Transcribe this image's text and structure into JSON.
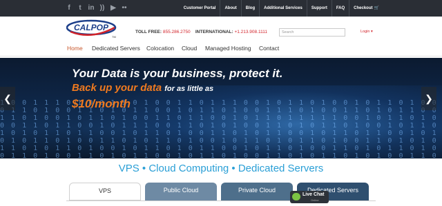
{
  "topbar": {
    "social_icons": [
      "facebook-icon",
      "twitter-icon",
      "linkedin-icon",
      "rss-icon",
      "youtube-icon",
      "flickr-icon"
    ],
    "links": [
      "Customer Portal",
      "About",
      "Blog",
      "Additional Services",
      "Support",
      "FAQ",
      "Checkout"
    ]
  },
  "header": {
    "logo_text": "CALPOP",
    "logo_tm": "TM",
    "toll_free_label": "TOLL FREE:",
    "toll_free_number": "855.286.2750",
    "international_label": "INTERNATIONAL:",
    "international_number": "+1.213.908.1111",
    "search_placeholder": "Search",
    "login_label": "Login"
  },
  "nav": {
    "items": [
      "Home",
      "Dedicated Servers",
      "Colocation",
      "Cloud",
      "Managed Hosting",
      "Contact"
    ],
    "active": "Home"
  },
  "hero": {
    "line1": "Your Data is your business, protect it.",
    "line2_highlight": "Back up your data",
    "line2_rest": "for as little as",
    "line3": "$10/month",
    "prev_arrow": "❮",
    "next_arrow": "❯"
  },
  "tagline": "VPS • Cloud Computing • Dedicated Servers",
  "tabs": [
    "VPS",
    "Public Cloud",
    "Private Cloud",
    "Dedicated Servers"
  ],
  "livechat": {
    "label": "Live Chat",
    "status": "Online"
  },
  "colors": {
    "brand_red": "#d2232a",
    "accent_orange": "#f07a1f",
    "tagline_blue": "#2a9fd6",
    "topbar_dark": "#2a2e35"
  }
}
